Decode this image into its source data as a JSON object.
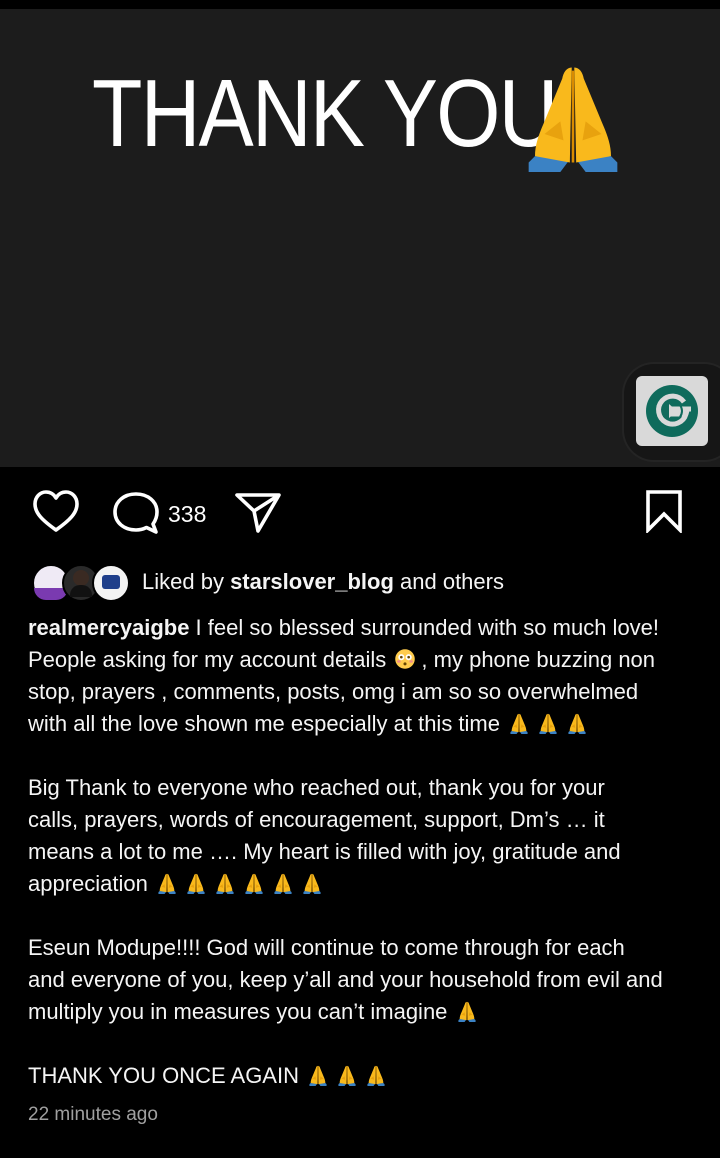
{
  "post": {
    "image_text": "THANK YOU",
    "image_emoji": "folded-hands"
  },
  "badge": {
    "icon": "g-logo-icon",
    "color": "#0f6b5c"
  },
  "actions": {
    "like_icon": "heart-outline-icon",
    "comment_icon": "comment-icon",
    "comment_count": "338",
    "share_icon": "send-icon",
    "save_icon": "bookmark-icon"
  },
  "likes": {
    "prefix": "Liked by ",
    "user": "starslover_blog",
    "suffix": " and others"
  },
  "caption": {
    "username": "realmercyaigbe",
    "line1": " I feel so blessed surrounded with so much love!",
    "line2a": "People asking for my account details ",
    "line2b": ", my phone buzzing non",
    "line3": "stop, prayers , comments, posts, omg i am so so overwhelmed",
    "line4": "with all the love shown me especially at this time ",
    "para2_line1": "Big Thank to everyone who reached out, thank you for your",
    "para2_line2": "calls, prayers, words of encouragement, support, Dm’s … it",
    "para2_line3": "means a lot to me …. My heart is filled with joy, gratitude and",
    "para2_line4": "appreciation ",
    "para3_line1": "Eseun Modupe!!!! God will continue to come through for each",
    "para3_line2": "and everyone of you, keep y’all and your household from evil and",
    "para3_line3": "multiply you in measures you can’t imagine ",
    "para4_line1": "THANK YOU ONCE AGAIN "
  },
  "timestamp": "22 minutes ago",
  "colors": {
    "post_bg": "#1c1c1c",
    "app_bg": "#000000",
    "muted": "#a0a0a0"
  }
}
